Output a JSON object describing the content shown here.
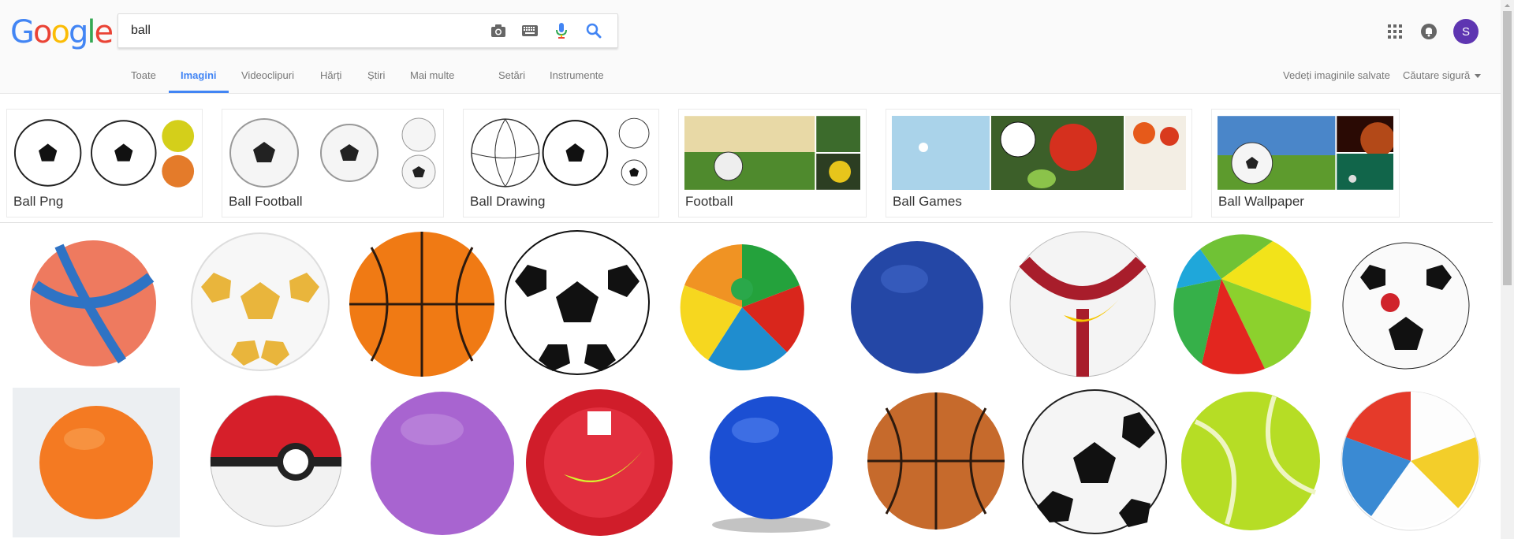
{
  "logo": {
    "letters": [
      "G",
      "o",
      "o",
      "g",
      "l",
      "e"
    ],
    "colors": [
      "#4285f4",
      "#ea4335",
      "#fbbc05",
      "#4285f4",
      "#34a853",
      "#ea4335"
    ]
  },
  "search": {
    "value": "ball",
    "placeholder": ""
  },
  "tabs": [
    {
      "label": "Toate"
    },
    {
      "label": "Imagini"
    },
    {
      "label": "Videoclipuri"
    },
    {
      "label": "Hărți"
    },
    {
      "label": "Știri"
    },
    {
      "label": "Mai multe"
    },
    {
      "label": "Setări"
    },
    {
      "label": "Instrumente"
    }
  ],
  "right": {
    "saved": "Vedeți imaginile salvate",
    "safe": "Căutare sigură"
  },
  "account": {
    "initial": "S"
  },
  "chips": [
    {
      "label": "Ball Png"
    },
    {
      "label": "Ball Football"
    },
    {
      "label": "Ball Drawing"
    },
    {
      "label": "Football"
    },
    {
      "label": "Ball Games"
    },
    {
      "label": "Ball Wallpaper"
    }
  ],
  "accent": "#4285f4"
}
